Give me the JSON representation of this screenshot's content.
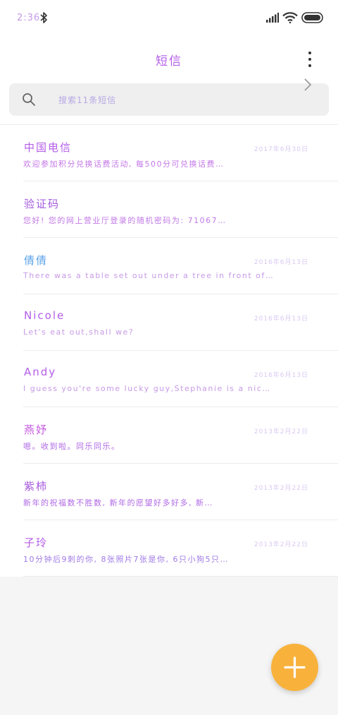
{
  "status_bar": {
    "time": "2:36",
    "icons": [
      "bluetooth-icon",
      "signal-icon",
      "wifi-icon",
      "battery-icon"
    ]
  },
  "header": {
    "title": "短信",
    "more_icon": "more-vertical-icon"
  },
  "search": {
    "placeholder": "搜索11条短信",
    "icon": "search-icon"
  },
  "messages": [
    {
      "name": "中国电信",
      "date": "2017年6月30日",
      "preview": "欢迎参加积分兑换话费活动, 每500分可兑换话费…",
      "name_color": "#b45ce8",
      "preview_color": "#c477e8"
    },
    {
      "name": "验证码",
      "date": "",
      "preview": "您好! 您的网上营业厅登录的随机密码为: 71067…",
      "name_color": "#a45ae0",
      "preview_color": "#c27ae6",
      "chevron": "chevron-right-icon"
    },
    {
      "name": "倩倩",
      "date": "2016年6月13日",
      "preview": "There was a table set out under a tree in front of…",
      "name_color": "#5aa2e8",
      "preview_color": "#c79be6"
    },
    {
      "name": "Nicole",
      "date": "2016年6月13日",
      "preview": "Let's eat out,shall we?",
      "name_color": "#b45ce8",
      "preview_color": "#c79be6"
    },
    {
      "name": "Andy",
      "date": "2016年6月13日",
      "preview": "I guess you're some lucky guy,Stephanie is a nic…",
      "name_color": "#b45ce8",
      "preview_color": "#c79be6"
    },
    {
      "name": "燕妤",
      "date": "2013年2月22日",
      "preview": "嗯。收到啦。同乐同乐。",
      "name_color": "#c45ae0",
      "preview_color": "#b06ae6"
    },
    {
      "name": "紫柿",
      "date": "2013年2月22日",
      "preview": "新年的祝福数不胜数, 新年的愿望好多好多, 新…",
      "name_color": "#a65ae0",
      "preview_color": "#b06ae6"
    },
    {
      "name": "子玲",
      "date": "2013年2月22日",
      "preview": "10分钟后9刺的你, 8张照片7张是你, 6只小狗5只…",
      "name_color": "#b45ce8",
      "preview_color": "#a07ae6"
    }
  ],
  "fab": {
    "icon": "plus-icon",
    "color": "#f8b23c"
  },
  "colors": {
    "accent": "#b45ce8",
    "background": "#f5f5f5",
    "search_bg": "#efefef",
    "date": "#d8c9f2"
  }
}
